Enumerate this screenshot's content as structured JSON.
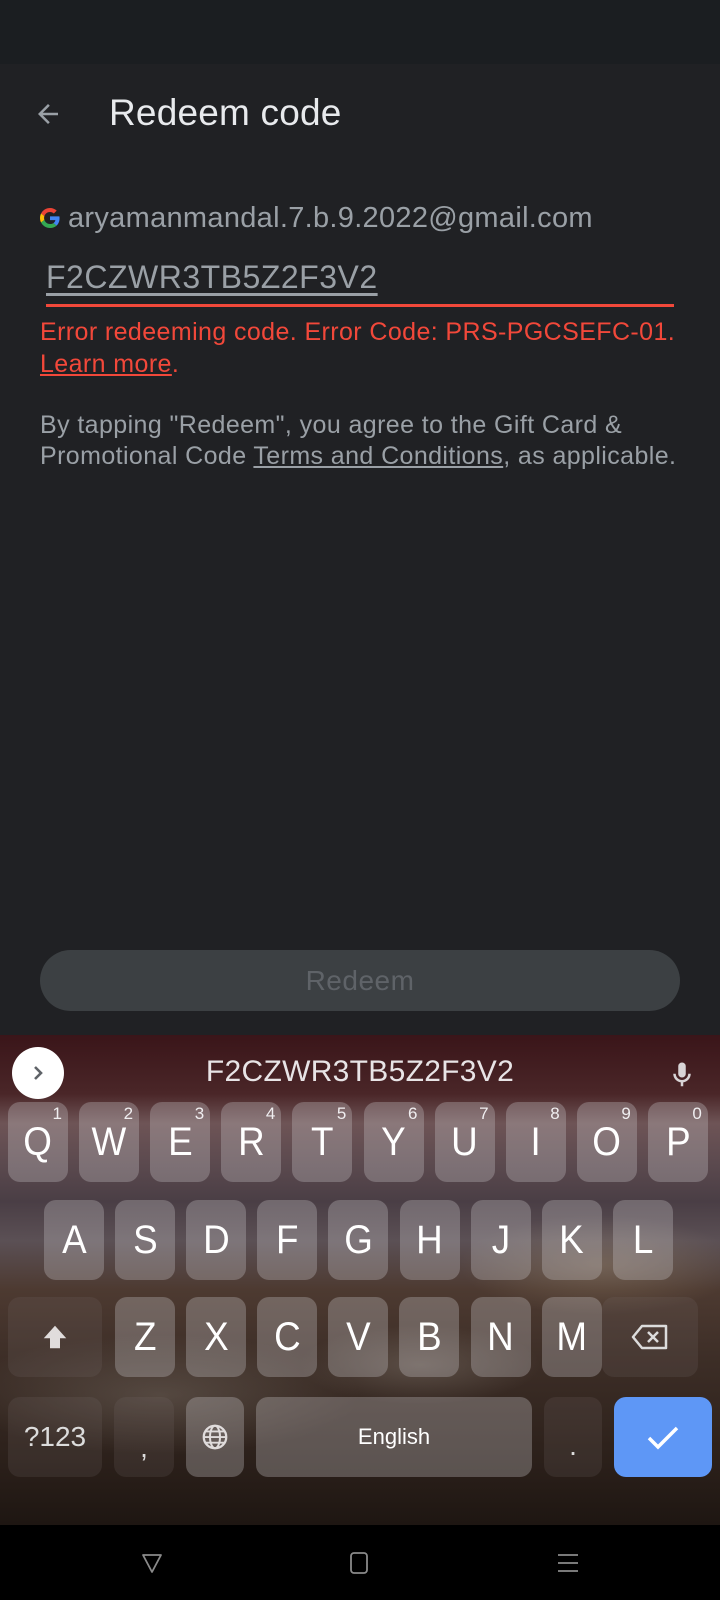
{
  "app_bar": {
    "title": "Redeem code",
    "back_icon": "arrow-back-icon"
  },
  "account": {
    "icon": "google-g-icon",
    "email": "aryamanmandal.7.b.9.2022@gmail.com"
  },
  "code_input": {
    "value": "F2CZWR3TB5Z2F3V2",
    "state": "error"
  },
  "error": {
    "text": "Error redeeming code. Error Code: PRS-PGCSEFC-01. ",
    "link_label": "Learn more",
    "suffix": "."
  },
  "terms": {
    "prefix": "By tapping \"Redeem\", you agree to the Gift Card & Promotional Code ",
    "link_label": "Terms and Conditions",
    "suffix": ", as applicable."
  },
  "redeem_button": {
    "label": "Redeem",
    "enabled": false
  },
  "keyboard": {
    "suggestion": "F2CZWR3TB5Z2F3V2",
    "expand_icon": "chevron-right-icon",
    "mic_icon": "microphone-icon",
    "row1": [
      {
        "label": "Q",
        "hint": "1"
      },
      {
        "label": "W",
        "hint": "2"
      },
      {
        "label": "E",
        "hint": "3"
      },
      {
        "label": "R",
        "hint": "4"
      },
      {
        "label": "T",
        "hint": "5"
      },
      {
        "label": "Y",
        "hint": "6"
      },
      {
        "label": "U",
        "hint": "7"
      },
      {
        "label": "I",
        "hint": "8"
      },
      {
        "label": "O",
        "hint": "9"
      },
      {
        "label": "P",
        "hint": "0"
      }
    ],
    "row2": [
      "A",
      "S",
      "D",
      "F",
      "G",
      "H",
      "J",
      "K",
      "L"
    ],
    "row3": [
      "Z",
      "X",
      "C",
      "V",
      "B",
      "N",
      "M"
    ],
    "shift_icon": "shift-icon",
    "backspace_icon": "backspace-icon",
    "symbols_label": "?123",
    "comma_label": ",",
    "globe_icon": "globe-icon",
    "space_label": "English",
    "period_label": ".",
    "enter_icon": "checkmark-icon",
    "colors": {
      "enter": "#5e97f6"
    }
  },
  "nav_bar": {
    "back_icon": "nav-back-triangle-icon",
    "home_icon": "nav-home-square-icon",
    "recents_icon": "nav-menu-lines-icon"
  },
  "colors": {
    "background": "#202124",
    "error": "#f2483a",
    "title": "#e8eaed",
    "secondary_text": "#9aa0a6"
  }
}
